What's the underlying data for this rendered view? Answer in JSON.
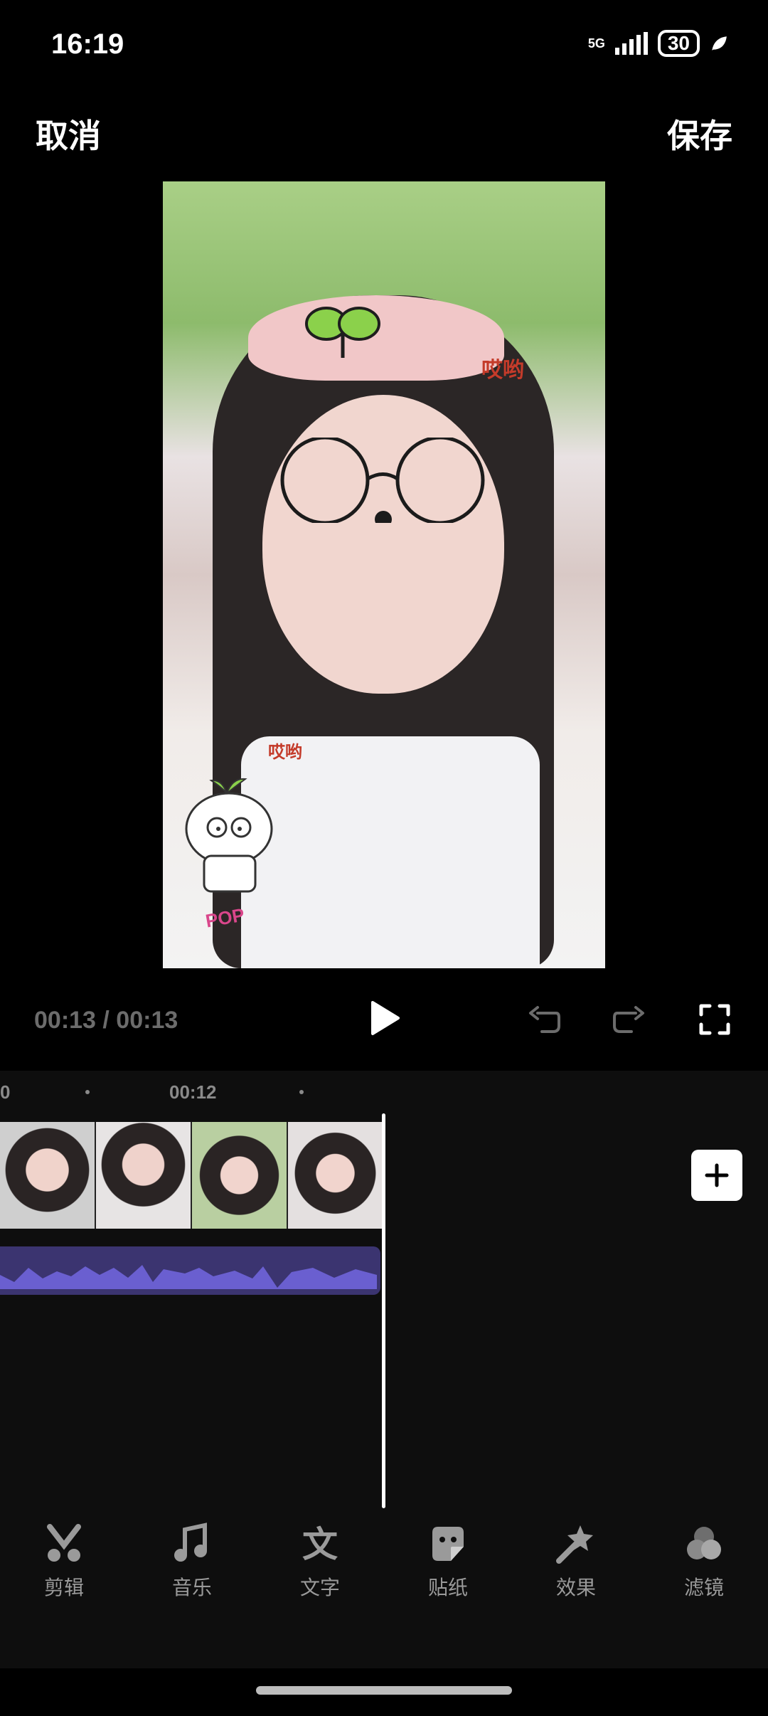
{
  "status_bar": {
    "time": "16:19",
    "network": "5G",
    "battery": "30"
  },
  "header": {
    "cancel_label": "取消",
    "save_label": "保存"
  },
  "preview": {
    "stickers": [
      "哎哟",
      "哎哟",
      "POP"
    ]
  },
  "playback": {
    "timecode": "00:13 / 00:13"
  },
  "timeline": {
    "ruler_labels": [
      "0",
      "00:12"
    ]
  },
  "toolbar": {
    "items": [
      {
        "label": "剪辑",
        "icon": "scissors-icon"
      },
      {
        "label": "音乐",
        "icon": "music-note-icon"
      },
      {
        "label": "文字",
        "icon": "text-icon"
      },
      {
        "label": "贴纸",
        "icon": "sticker-icon"
      },
      {
        "label": "效果",
        "icon": "magic-wand-icon"
      },
      {
        "label": "滤镜",
        "icon": "filter-icon"
      }
    ]
  },
  "colors": {
    "background": "#000000",
    "panel": "#0e0e0e",
    "audio_track": "#3b3470",
    "waveform": "#6a5fd0"
  }
}
